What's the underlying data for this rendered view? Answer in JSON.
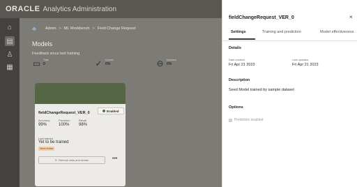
{
  "app": {
    "logo": "ORACLE",
    "name": "Analytics Administration"
  },
  "breadcrumb": [
    "Admin",
    "ML Workbench",
    "Field Change Request"
  ],
  "models": {
    "title": "Models",
    "feedback_title": "Feedback since last training",
    "metrics": [
      {
        "icon": "feedback-icon",
        "label": "Total",
        "value": "0"
      },
      {
        "icon": "check-circle-icon",
        "label": "Correct",
        "value": "0%"
      },
      {
        "icon": "minus-circle-icon",
        "label": "Incorrect",
        "value": "0%"
      }
    ]
  },
  "card": {
    "name": "fieldChangeRequest_VER_0",
    "badge": "Enabled",
    "accuracy_label": "Accuracy",
    "accuracy": "99%",
    "precision_label": "Precision",
    "precision": "100%",
    "recall_label": "Recall",
    "recall": "98%",
    "last_trained_label": "Last trained",
    "last_trained": "Yet to be trained",
    "tag": "Need review",
    "refresh_label": "Refresh data and retrain",
    "more": "•••"
  },
  "panel": {
    "title": "fieldChangeRequest_VER_0",
    "close": "×",
    "tabs": [
      "Settings",
      "Training and prediction",
      "Model effectiveness"
    ],
    "details_title": "Details",
    "date_created_label": "Date created",
    "date_created": "Fri Apr 21 2023",
    "last_updated_label": "Last updated",
    "last_updated": "Fri Apr 21 2023",
    "description_title": "Description",
    "description": "Seed Model trained by sample dataset",
    "options_title": "Options",
    "prediction_label": "Prediction enabled"
  },
  "colors": {
    "banner": "#556644",
    "badge_dot": "#4e7a3a",
    "tag_bg": "#f2cfa6"
  }
}
